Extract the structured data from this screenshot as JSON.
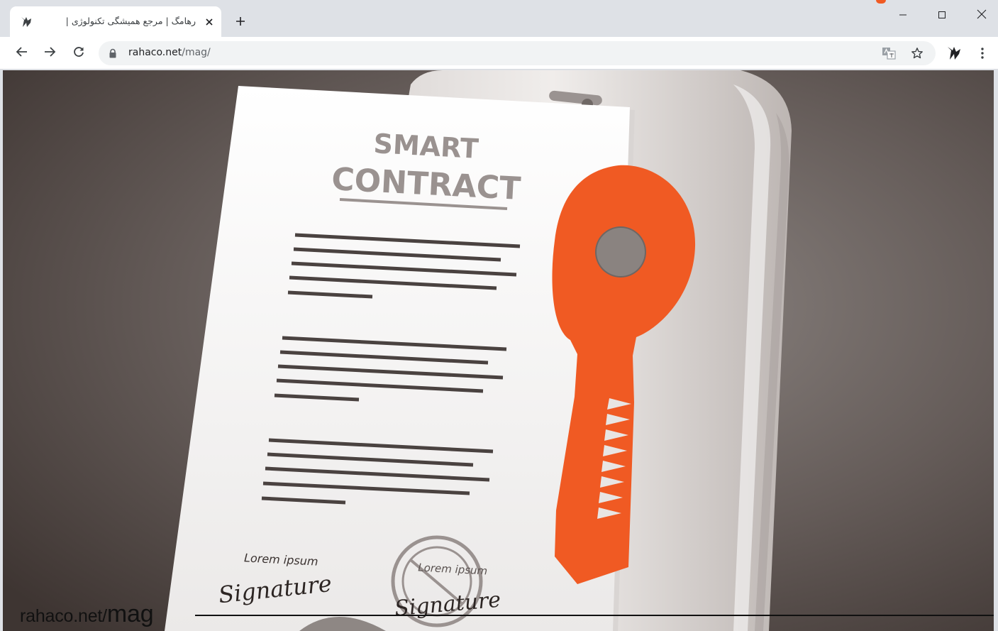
{
  "browser": {
    "tab": {
      "title": "رهامگ | مرجع همیشگی تکنولوژی |",
      "favicon": "rahaco-logo-icon",
      "close_icon": "close-icon"
    },
    "new_tab_icon": "plus-icon",
    "window_controls": {
      "minimize_icon": "minimize-icon",
      "maximize_icon": "maximize-icon",
      "close_icon": "close-icon"
    },
    "nav": {
      "back_icon": "arrow-left-icon",
      "forward_icon": "arrow-right-icon",
      "reload_icon": "reload-icon"
    },
    "address_bar": {
      "lock_icon": "lock-icon",
      "host": "rahaco.net",
      "path": "/mag/"
    },
    "toolbar_icons": [
      "translate-icon",
      "star-icon",
      "extension-icon",
      "more-vertical-icon"
    ]
  },
  "page": {
    "document": {
      "heading_line1": "SMART",
      "heading_line2": "CONTRACT",
      "sign_left_label": "Lorem ipsum",
      "sign_left_script": "Signature",
      "stamp_label": "Lorem ipsum",
      "stamp_script": "Signature"
    },
    "watermark": {
      "site": "rahaco.net/",
      "section": "mag"
    }
  },
  "colors": {
    "accent_orange": "#f05a23",
    "tab_strip": "#dee1e6",
    "background_dark": "#4a403d"
  }
}
